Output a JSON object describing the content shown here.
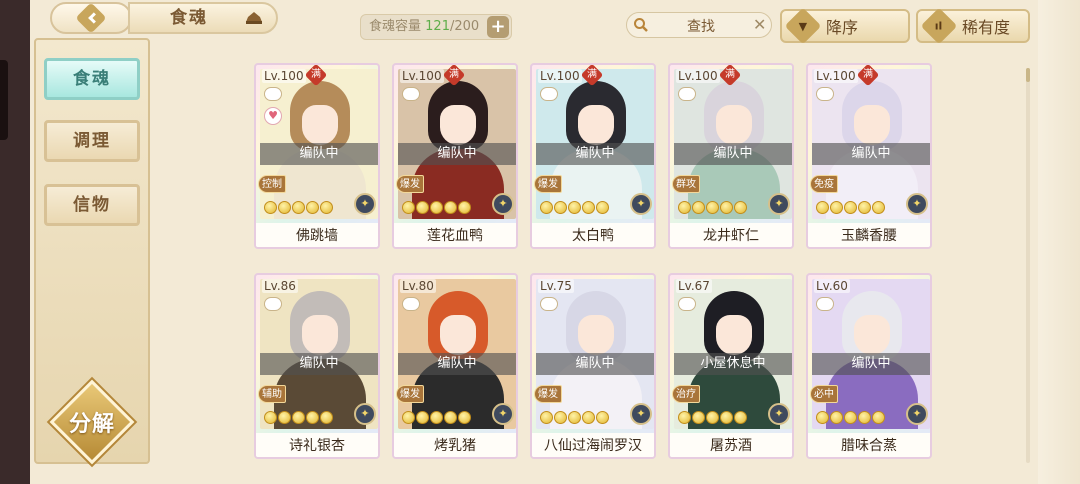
{
  "header": {
    "title": "食魂",
    "capacity_label": "食魂容量",
    "capacity_current": "121",
    "capacity_total": "/200",
    "capacity_add": "+",
    "search_label": "查找",
    "search_clear": "✕",
    "sort_order_label": "降序",
    "sort_rarity_label": "稀有度",
    "sort_order_icon": "▼",
    "sort_rarity_icon": "ıl"
  },
  "sidebar": {
    "items": [
      {
        "label": "食魂",
        "active": true
      },
      {
        "label": "调理",
        "active": false
      },
      {
        "label": "信物",
        "active": false
      }
    ],
    "decompose_label": "分解"
  },
  "max_badge": "满",
  "cards": [
    {
      "level": "Lv.100",
      "max": true,
      "status": "编队中",
      "role": "控制",
      "name": "佛跳墙",
      "stars": 5,
      "heart": true,
      "colors": {
        "hair": "#b58c5a",
        "robe": "#efe6d0",
        "bg": "#f6f0d0"
      }
    },
    {
      "level": "Lv.100",
      "max": true,
      "status": "编队中",
      "role": "爆发",
      "name": "莲花血鸭",
      "stars": 5,
      "heart": false,
      "colors": {
        "hair": "#2b1d1d",
        "robe": "#8a2b22",
        "bg": "#d9c3a8"
      }
    },
    {
      "level": "Lv.100",
      "max": true,
      "status": "编队中",
      "role": "爆发",
      "name": "太白鸭",
      "stars": 5,
      "heart": false,
      "colors": {
        "hair": "#2a2a30",
        "robe": "#eaf3f2",
        "bg": "#cfe9ec"
      }
    },
    {
      "level": "Lv.100",
      "max": true,
      "status": "编队中",
      "role": "群攻",
      "name": "龙井虾仁",
      "stars": 5,
      "heart": false,
      "colors": {
        "hair": "#d9d4dc",
        "robe": "#a9c9b8",
        "bg": "#dfe5e0"
      }
    },
    {
      "level": "Lv.100",
      "max": true,
      "status": "编队中",
      "role": "免疫",
      "name": "玉麟香腰",
      "stars": 5,
      "heart": false,
      "colors": {
        "hair": "#dcd6ea",
        "robe": "#f2eef7",
        "bg": "#ece4f0"
      }
    },
    {
      "level": "Lv.86",
      "max": false,
      "status": "编队中",
      "role": "辅助",
      "name": "诗礼银杏",
      "stars": 5,
      "heart": false,
      "colors": {
        "hair": "#c2bcb8",
        "robe": "#5a4a36",
        "bg": "#efe4c2"
      }
    },
    {
      "level": "Lv.80",
      "max": false,
      "status": "编队中",
      "role": "爆发",
      "name": "烤乳猪",
      "stars": 5,
      "heart": false,
      "colors": {
        "hair": "#d75a2a",
        "robe": "#2b2b2b",
        "bg": "#e9c9a0"
      }
    },
    {
      "level": "Lv.75",
      "max": false,
      "status": "编队中",
      "role": "爆发",
      "name": "八仙过海闹罗汉",
      "stars": 5,
      "heart": false,
      "colors": {
        "hair": "#d7d7e6",
        "robe": "#f3f1f6",
        "bg": "#e4e6f2"
      }
    },
    {
      "level": "Lv.67",
      "max": false,
      "status": "小屋休息中",
      "role": "治疗",
      "name": "屠苏酒",
      "stars": 5,
      "heart": false,
      "colors": {
        "hair": "#1e1e24",
        "robe": "#2e4a3c",
        "bg": "#e6ecde"
      }
    },
    {
      "level": "Lv.60",
      "max": false,
      "status": "编队中",
      "role": "必中",
      "name": "腊味合蒸",
      "stars": 5,
      "heart": false,
      "colors": {
        "hair": "#e8e8ee",
        "robe": "#8a6cc0",
        "bg": "#e4d9f2"
      }
    }
  ]
}
